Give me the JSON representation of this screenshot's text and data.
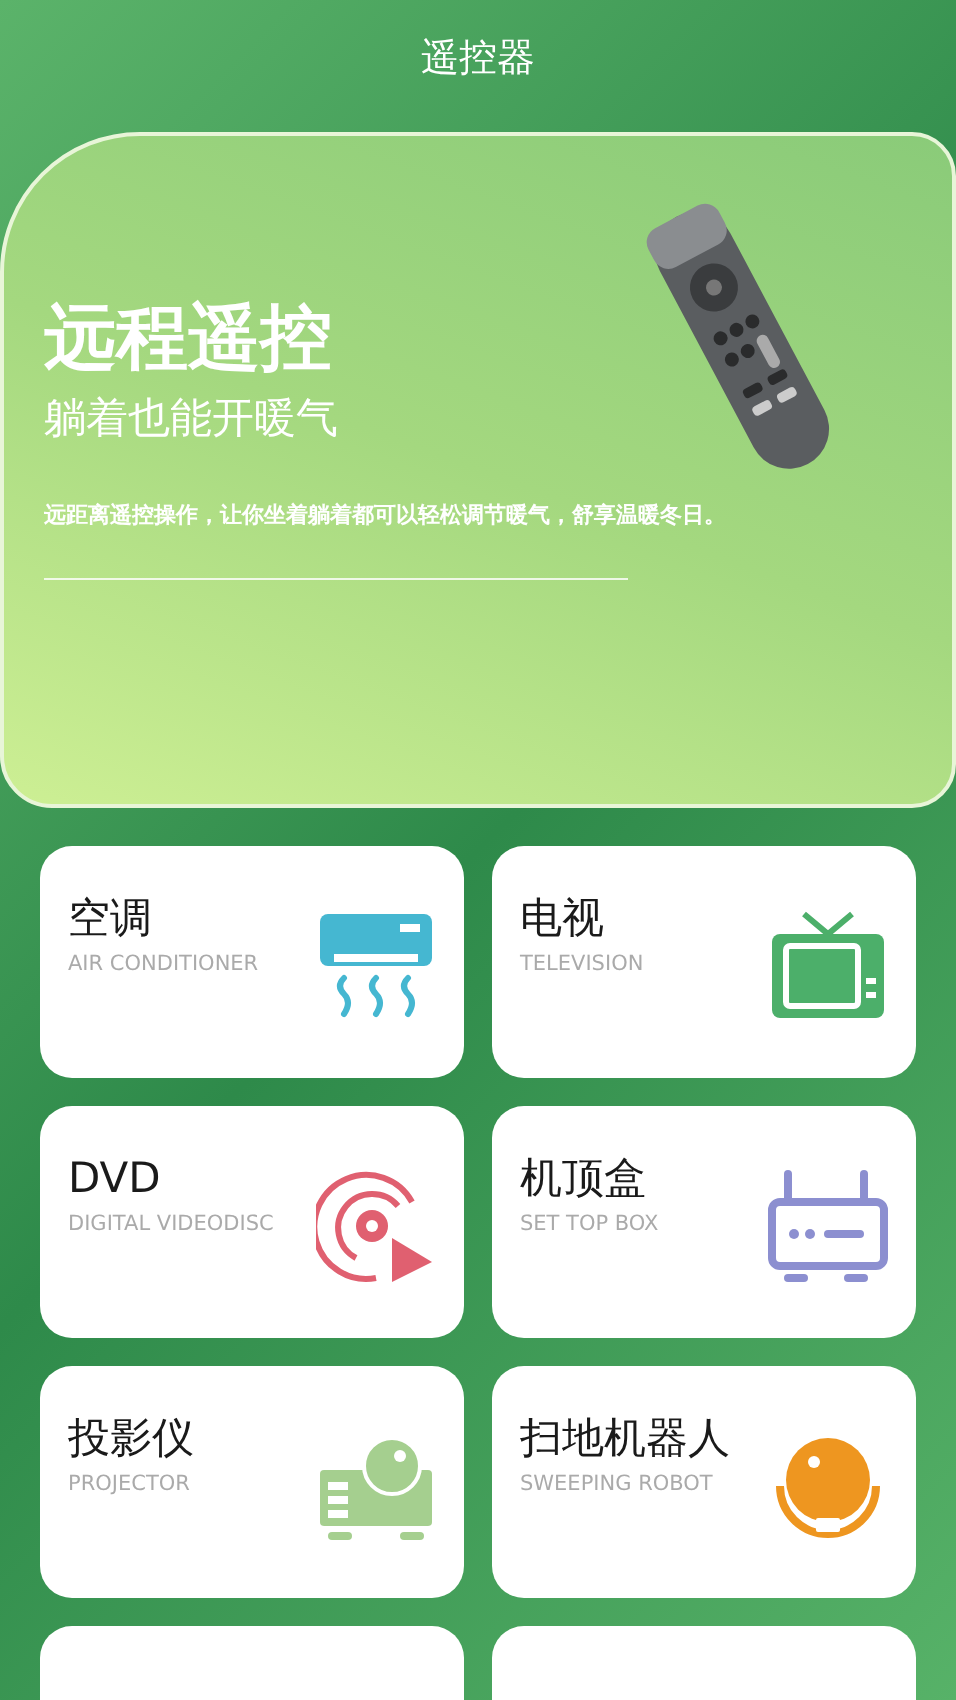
{
  "header": {
    "title": "遥控器"
  },
  "banner": {
    "headline": "远程遥控",
    "subtitle": "躺着也能开暖气",
    "description": "远距离遥控操作，让你坐着躺着都可以轻松调节暖气，舒享温暖冬日。"
  },
  "devices": [
    {
      "kind": "ac",
      "name": "空调",
      "english": "AIR CONDITIONER"
    },
    {
      "kind": "tv",
      "name": "电视",
      "english": "TELEVISION"
    },
    {
      "kind": "dvd",
      "name": "DVD",
      "english": "DIGITAL VIDEODISC"
    },
    {
      "kind": "stb",
      "name": "机顶盒",
      "english": "SET TOP BOX"
    },
    {
      "kind": "projector",
      "name": "投影仪",
      "english": "PROJECTOR"
    },
    {
      "kind": "robot",
      "name": "扫地机器人",
      "english": "SWEEPING ROBOT"
    },
    {
      "kind": "blank"
    },
    {
      "kind": "blank"
    }
  ]
}
